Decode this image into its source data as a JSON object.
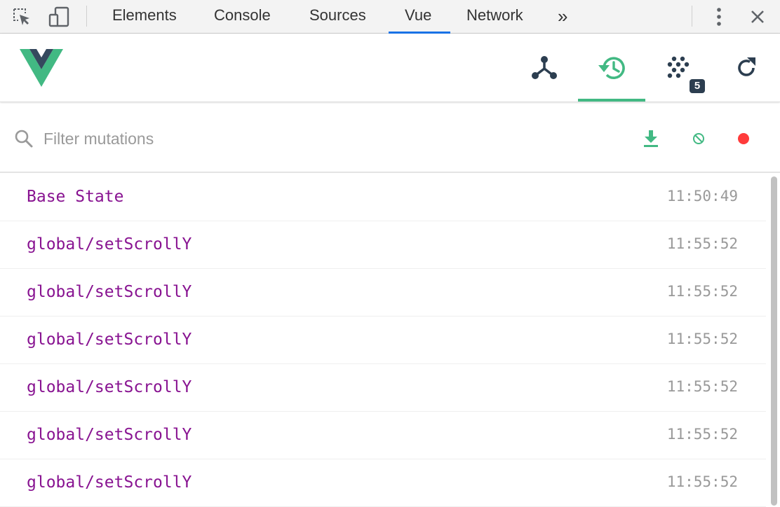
{
  "devtools": {
    "tabs": [
      {
        "label": "Elements"
      },
      {
        "label": "Console"
      },
      {
        "label": "Sources"
      },
      {
        "label": "Vue"
      },
      {
        "label": "Network"
      }
    ],
    "more_tabs_glyph": "»",
    "active_tab": "Vue",
    "icons": [
      "inspect-element-icon",
      "device-toolbar-icon",
      "more-options-icon",
      "close-icon"
    ]
  },
  "vue_header": {
    "tools": [
      "components-icon",
      "vuex-history-icon",
      "events-icon",
      "refresh-icon"
    ],
    "active_tool": "vuex-history-icon",
    "events_badge": "5"
  },
  "filter": {
    "placeholder": "Filter mutations",
    "value": "",
    "actions": [
      "export-icon",
      "clear-icon",
      "record-icon"
    ]
  },
  "mutations": [
    {
      "name": "Base State",
      "time": "11:50:49"
    },
    {
      "name": "global/setScrollY",
      "time": "11:55:52"
    },
    {
      "name": "global/setScrollY",
      "time": "11:55:52"
    },
    {
      "name": "global/setScrollY",
      "time": "11:55:52"
    },
    {
      "name": "global/setScrollY",
      "time": "11:55:52"
    },
    {
      "name": "global/setScrollY",
      "time": "11:55:52"
    },
    {
      "name": "global/setScrollY",
      "time": "11:55:52"
    }
  ],
  "colors": {
    "vue_green": "#42b983",
    "vue_dark": "#2c3e50",
    "mutation_name": "#881391",
    "timestamp": "#999999",
    "record_red": "#ff3b3b",
    "tab_underline": "#1a73e8"
  }
}
